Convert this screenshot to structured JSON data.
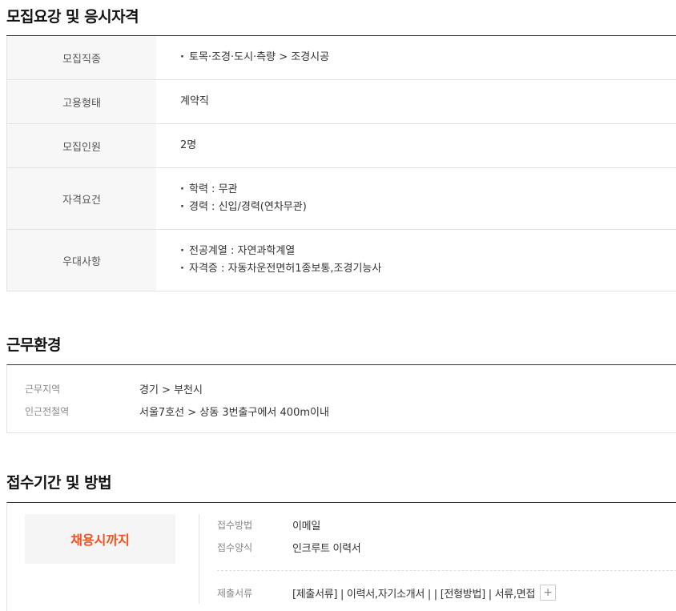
{
  "sections": {
    "requirements_title": "모집요강 및 응시자격",
    "environment_title": "근무환경",
    "application_title": "접수기간 및 방법"
  },
  "requirements": {
    "job_type_label": "모집직종",
    "job_type_value": "토목·조경·도시·측량 > 조경시공",
    "employment_label": "고용형태",
    "employment_value": "계약직",
    "headcount_label": "모집인원",
    "headcount_value": "2명",
    "qualification_label": "자격요건",
    "qualification_items": [
      "학력 : 무관",
      "경력 : 신입/경력(연차무관)"
    ],
    "preference_label": "우대사항",
    "preference_items": [
      "전공계열 : 자연과학계열",
      "자격증 : 자동차운전면허1종보통,조경기능사"
    ]
  },
  "environment": {
    "location_label": "근무지역",
    "location_value": "경기 > 부천시",
    "station_label": "인근전철역",
    "station_value": "서울7호선 > 상동 3번출구에서 400m이내"
  },
  "application": {
    "deadline": "채용시까지",
    "method_label": "접수방법",
    "method_value": "이메일",
    "form_label": "접수양식",
    "form_value": "인크루트 이력서",
    "docs_label": "제출서류",
    "docs_value": "[제출서류] | 이력서,자기소개서 | | [전형방법] | 서류,면접",
    "more_symbol": "+"
  }
}
